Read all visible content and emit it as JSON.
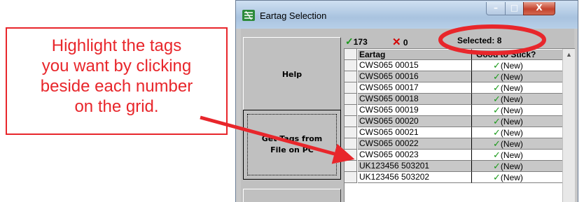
{
  "window": {
    "title": "Eartag Selection",
    "controls": {
      "minimize": "–",
      "maximize": "□",
      "close": "X"
    }
  },
  "buttons": {
    "help": "Help",
    "get_tags_line1": "Get Tags from",
    "get_tags_line2": "File on PC"
  },
  "status": {
    "check_count": "173",
    "x_count": "0",
    "selected": "Selected: 8"
  },
  "grid": {
    "columns": [
      "Eartag",
      "Good to Stick?"
    ],
    "rows": [
      {
        "tag": "CWS065 00015",
        "status": "(New)"
      },
      {
        "tag": "CWS065 00016",
        "status": "(New)"
      },
      {
        "tag": "CWS065 00017",
        "status": "(New)"
      },
      {
        "tag": "CWS065 00018",
        "status": "(New)"
      },
      {
        "tag": "CWS065 00019",
        "status": "(New)"
      },
      {
        "tag": "CWS065 00020",
        "status": "(New)"
      },
      {
        "tag": "CWS065 00021",
        "status": "(New)"
      },
      {
        "tag": "CWS065 00022",
        "status": "(New)"
      },
      {
        "tag": "CWS065 00023",
        "status": "(New)"
      },
      {
        "tag": "UK123456 503201",
        "status": "(New)"
      },
      {
        "tag": "UK123456 503202",
        "status": "(New)"
      }
    ]
  },
  "annotation": {
    "lines": [
      "Highlight the tags",
      "you want by clicking",
      "beside each number",
      "on the grid."
    ],
    "color": "#e8262b"
  }
}
